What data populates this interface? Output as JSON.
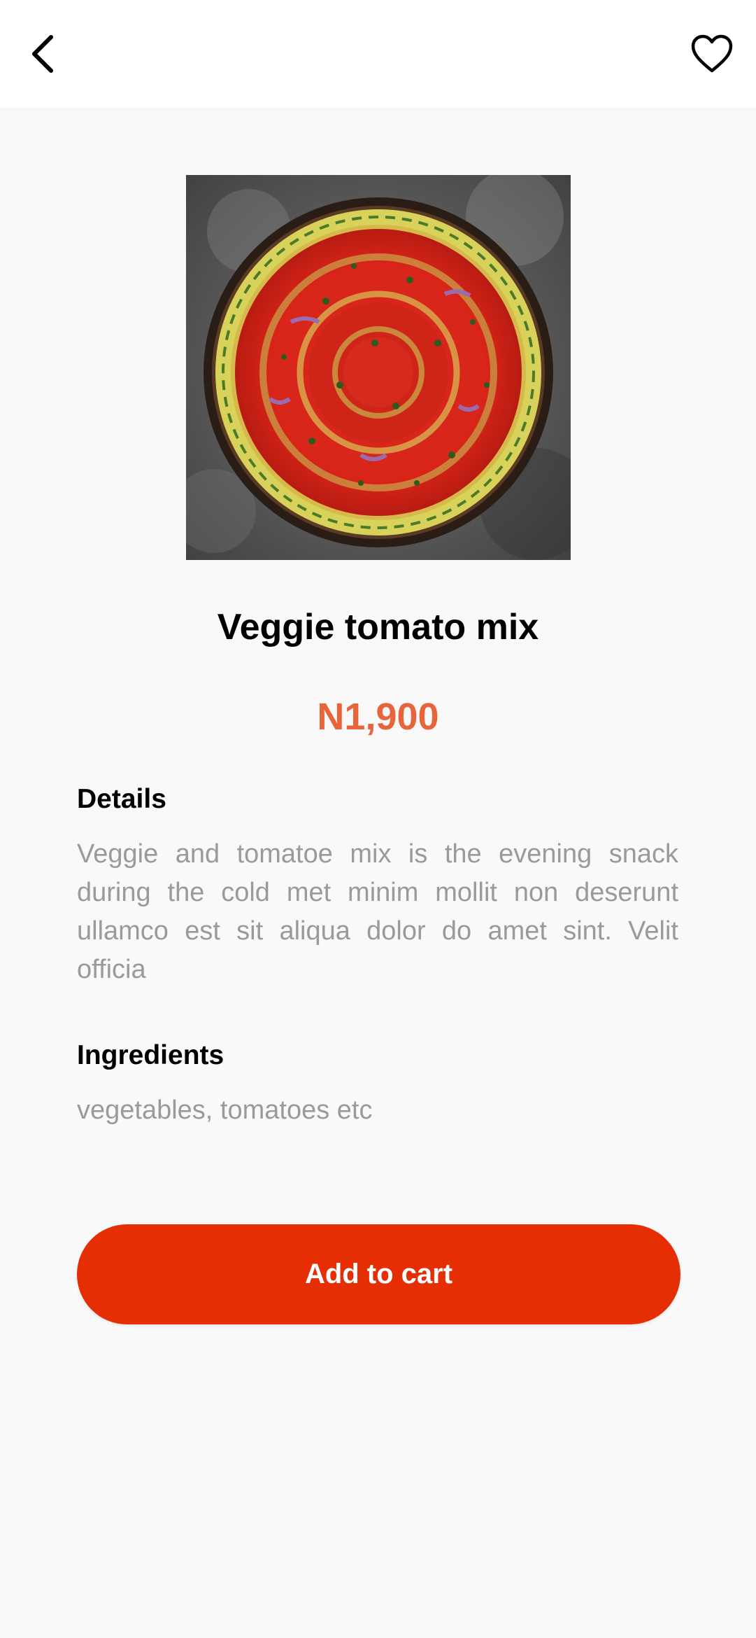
{
  "header": {
    "back_icon": "chevron-left-icon",
    "favorite_icon": "heart-outline-icon"
  },
  "product": {
    "image_description_icon": "food-photo",
    "name": "Veggie tomato mix",
    "price": "N1,900"
  },
  "details": {
    "heading": "Details",
    "text": "Veggie and tomatoe mix is the evening snack during the cold met minim mollit non deserunt ullamco est sit aliqua dolor do amet sint. Velit officia"
  },
  "ingredients": {
    "heading": "Ingredients",
    "text": "vegetables, tomatoes etc"
  },
  "actions": {
    "add_to_cart_label": "Add to cart"
  },
  "colors": {
    "accent": "#e62e05",
    "price": "#e8653c",
    "muted_text": "#9a9a9a",
    "background": "#f9f9f9"
  }
}
